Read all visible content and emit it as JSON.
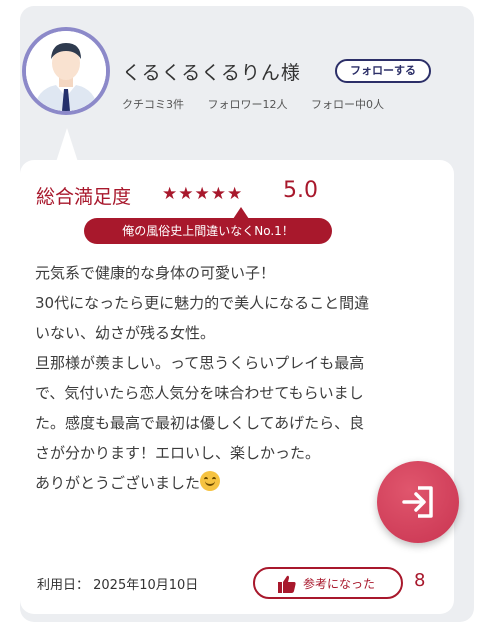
{
  "reviewer": {
    "name": "くるくるくるりん様",
    "follow_label": "フォローする",
    "stats": [
      "クチコミ3件",
      "フォロワー12人",
      "フォロー中0人"
    ]
  },
  "review": {
    "satisfaction_label": "総合満足度",
    "stars": "★★★★★",
    "rating": 5.0,
    "score": "5.0",
    "headline": "俺の風俗史上間違いなくNo.1！",
    "body_lines": [
      "元気系で健康的な身体の可愛い子！",
      "30代になったら更に魅力的で美人になること間違",
      "いない、幼さが残る女性。",
      "旦那様が羨ましい。って思うくらいプレイも最高",
      "で、気付いたら恋人気分を味合わせてもらいまし",
      "た。感度も最高で最初は優しくしてあげたら、良",
      "さが分かります！エロいし、楽しかった。",
      "ありがとうございました"
    ],
    "date": "利用日：  2025年10月10日",
    "helpful_label": "参考になった",
    "helpful_count": "8"
  },
  "icons": {
    "fab": "login-arrow-icon",
    "helpful": "thumbs-up-icon",
    "emoji": "smiling-face-emoji"
  },
  "colors": {
    "accent": "#a8182c",
    "follow": "#2c2f68",
    "avatar_ring": "#8c89c9",
    "fab": "#c93451"
  }
}
